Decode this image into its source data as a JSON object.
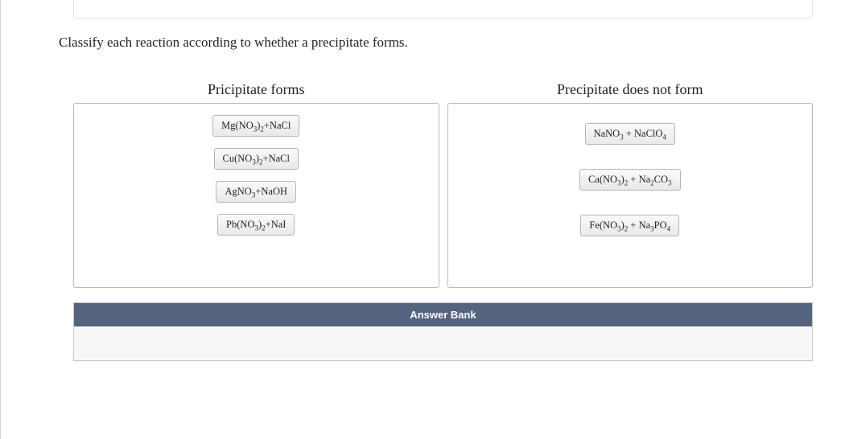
{
  "instruction": "Classify each reaction according to whether a precipitate forms.",
  "bins": {
    "left": {
      "title": "Pricipitate forms",
      "items": [
        {
          "html": "Mg(NO<sub>3</sub>)<sub>2</sub>+NaCl"
        },
        {
          "html": "Cu(NO<sub>3</sub>)<sub>2</sub>+NaCl"
        },
        {
          "html": "AgNO<sub>3</sub>+NaOH"
        },
        {
          "html": "Pb(NO<sub>3</sub>)<sub>2</sub>+NaI"
        }
      ]
    },
    "right": {
      "title": "Precipitate does not form",
      "items": [
        {
          "html": "NaNO<sub>3</sub> + NaClO<sub>4</sub>"
        },
        {
          "html": "Ca(NO<sub>3</sub>)<sub>2</sub> + Na<sub>2</sub>CO<sub>3</sub>"
        },
        {
          "html": "Fe(NO<sub>3</sub>)<sub>2</sub> + Na<sub>3</sub>PO<sub>4</sub>"
        }
      ]
    }
  },
  "answerBank": {
    "title": "Answer Bank"
  }
}
